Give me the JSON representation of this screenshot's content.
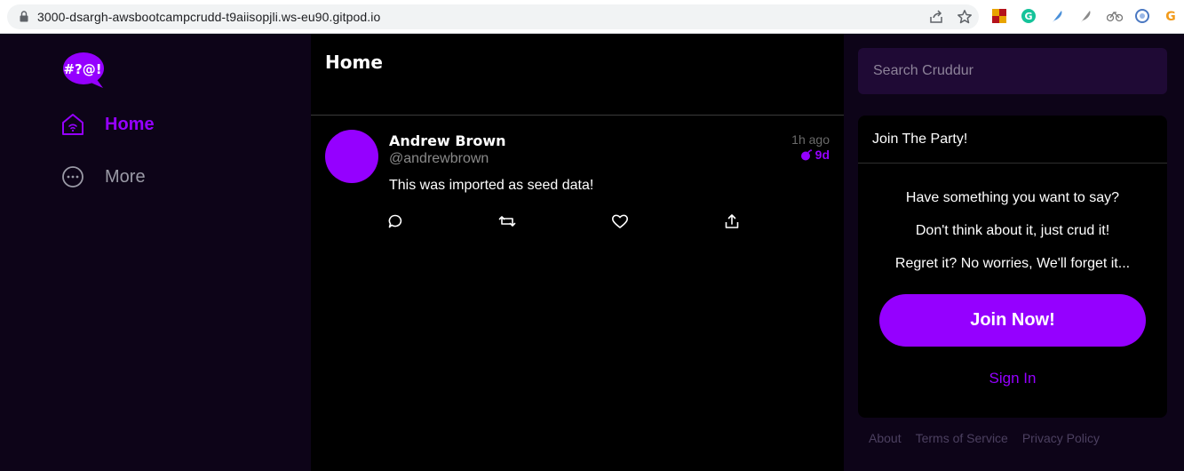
{
  "browser": {
    "url": "3000-dsargh-awsbootcampcrudd-t9aiisopjli.ws-eu90.gitpod.io"
  },
  "sidebar": {
    "logo_text": "#?@!",
    "items": [
      {
        "label": "Home",
        "icon": "home-icon",
        "active": true
      },
      {
        "label": "More",
        "icon": "more-icon",
        "active": false
      }
    ]
  },
  "feed": {
    "title": "Home",
    "activities": [
      {
        "display_name": "Andrew Brown",
        "handle": "@andrewbrown",
        "time_ago": "1h ago",
        "expires": "9d",
        "message": "This was imported as seed data!"
      }
    ]
  },
  "search": {
    "placeholder": "Search Cruddur"
  },
  "join": {
    "title": "Join The Party!",
    "lines": [
      "Have something you want to say?",
      "Don't think about it, just crud it!",
      "Regret it? No worries, We'll forget it..."
    ],
    "button_label": "Join Now!",
    "signin_label": "Sign In"
  },
  "footer": {
    "links": [
      "About",
      "Terms of Service",
      "Privacy Policy"
    ]
  },
  "colors": {
    "accent": "#9500ff",
    "sidebar_bg": "#0d0418",
    "feed_bg": "#000000",
    "search_bg": "#1f0a35"
  }
}
